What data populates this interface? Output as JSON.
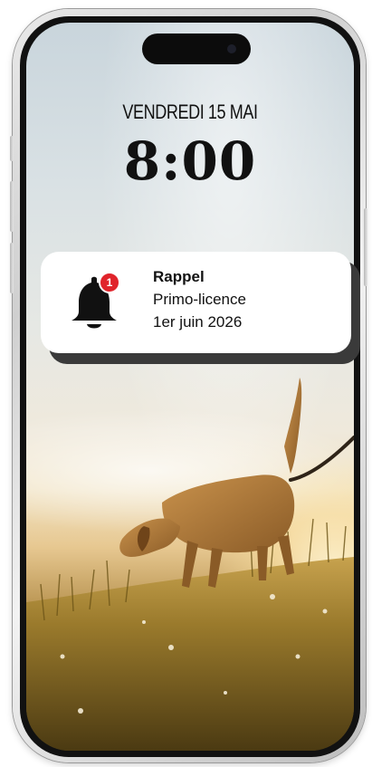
{
  "lockscreen": {
    "date": "VENDREDI 15 MAI",
    "time": "8:00"
  },
  "notification": {
    "icon": "bell-icon",
    "badge_count": "1",
    "title": "Rappel",
    "line1": "Primo-licence",
    "line2": "1er juin 2026"
  },
  "colors": {
    "badge": "#e0242b",
    "text": "#111111",
    "card_background": "#ffffff"
  }
}
